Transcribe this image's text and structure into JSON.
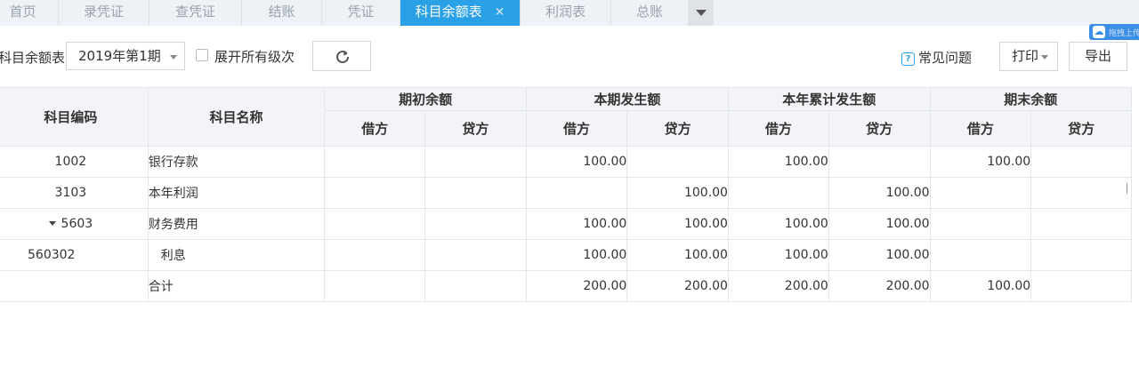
{
  "tabs": [
    {
      "label": "首页"
    },
    {
      "label": "录凭证"
    },
    {
      "label": "查凭证"
    },
    {
      "label": "结账"
    },
    {
      "label": "凭证"
    },
    {
      "label": "科目余额表",
      "active": true
    },
    {
      "label": "利润表"
    },
    {
      "label": "总账"
    }
  ],
  "toolbar": {
    "report_label": "科目余额表",
    "period_value": "2019年第1期",
    "expand_all_label": "展开所有级次",
    "expand_all_checked": false,
    "faq_label": "常见问题",
    "print_label": "打印",
    "export_label": "导出"
  },
  "widget": {
    "text": "拖拽上传"
  },
  "table": {
    "headers": {
      "code": "科目编码",
      "name": "科目名称",
      "opening": "期初余额",
      "period": "本期发生额",
      "ytd": "本年累计发生额",
      "closing": "期末余额",
      "debit": "借方",
      "credit": "贷方"
    },
    "rows": [
      {
        "code": "1002",
        "name": "银行存款",
        "opening_debit": "",
        "opening_credit": "",
        "period_debit": "100.00",
        "period_credit": "",
        "ytd_debit": "100.00",
        "ytd_credit": "",
        "closing_debit": "100.00",
        "closing_credit": ""
      },
      {
        "code": "3103",
        "name": "本年利润",
        "opening_debit": "",
        "opening_credit": "",
        "period_debit": "",
        "period_credit": "100.00",
        "ytd_debit": "",
        "ytd_credit": "100.00",
        "closing_debit": "",
        "closing_credit": ""
      },
      {
        "code": "5603",
        "name": "财务费用",
        "expanded": true,
        "opening_debit": "",
        "opening_credit": "",
        "period_debit": "100.00",
        "period_credit": "100.00",
        "ytd_debit": "100.00",
        "ytd_credit": "100.00",
        "closing_debit": "",
        "closing_credit": ""
      },
      {
        "code": "560302",
        "name": "利息",
        "child": true,
        "opening_debit": "",
        "opening_credit": "",
        "period_debit": "100.00",
        "period_credit": "100.00",
        "ytd_debit": "100.00",
        "ytd_credit": "100.00",
        "closing_debit": "",
        "closing_credit": ""
      },
      {
        "code": "",
        "name": "合计",
        "opening_debit": "",
        "opening_credit": "",
        "period_debit": "200.00",
        "period_credit": "200.00",
        "ytd_debit": "200.00",
        "ytd_credit": "200.00",
        "closing_debit": "100.00",
        "closing_credit": ""
      }
    ]
  },
  "colors": {
    "accent": "#2aa0e6",
    "header_bg": "#f2f4f7",
    "tabbar_bg": "#eef1f6"
  }
}
